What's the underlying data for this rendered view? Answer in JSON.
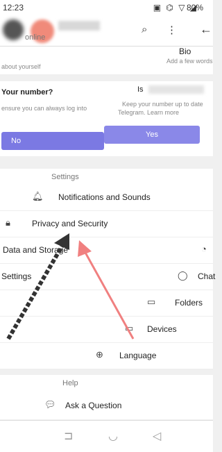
{
  "status": {
    "time": "12:23",
    "icons": "▣ ⌬ ▽ ◢",
    "battery": "80%"
  },
  "header": {
    "online": "online"
  },
  "bio": {
    "title": "Bio",
    "hint": "Add a few words"
  },
  "about": {
    "hint": "about yourself"
  },
  "phone_left": {
    "question": "Your number?",
    "sub": "ensure you can always log into",
    "no_label": "No"
  },
  "phone_right": {
    "title": "Is",
    "sub1": "Keep your number up to date",
    "sub2": "Telegram. Learn more",
    "yes_label": "Yes"
  },
  "settings": {
    "header": "Settings",
    "items": [
      {
        "label": "Notifications and Sounds"
      },
      {
        "label": "Privacy and Security"
      },
      {
        "label": "Data and Storage"
      },
      {
        "label": "Chat"
      },
      {
        "label": "Settings"
      },
      {
        "label": "Folders"
      },
      {
        "label": "Devices"
      },
      {
        "label": "Language"
      }
    ]
  },
  "help": {
    "header": "Help",
    "items": [
      {
        "label": "Ask a Question"
      }
    ]
  },
  "colors": {
    "accent": "#7b79e3",
    "muted": "#888888",
    "arrow_pink": "#f08080",
    "arrow_dark": "#333333"
  }
}
